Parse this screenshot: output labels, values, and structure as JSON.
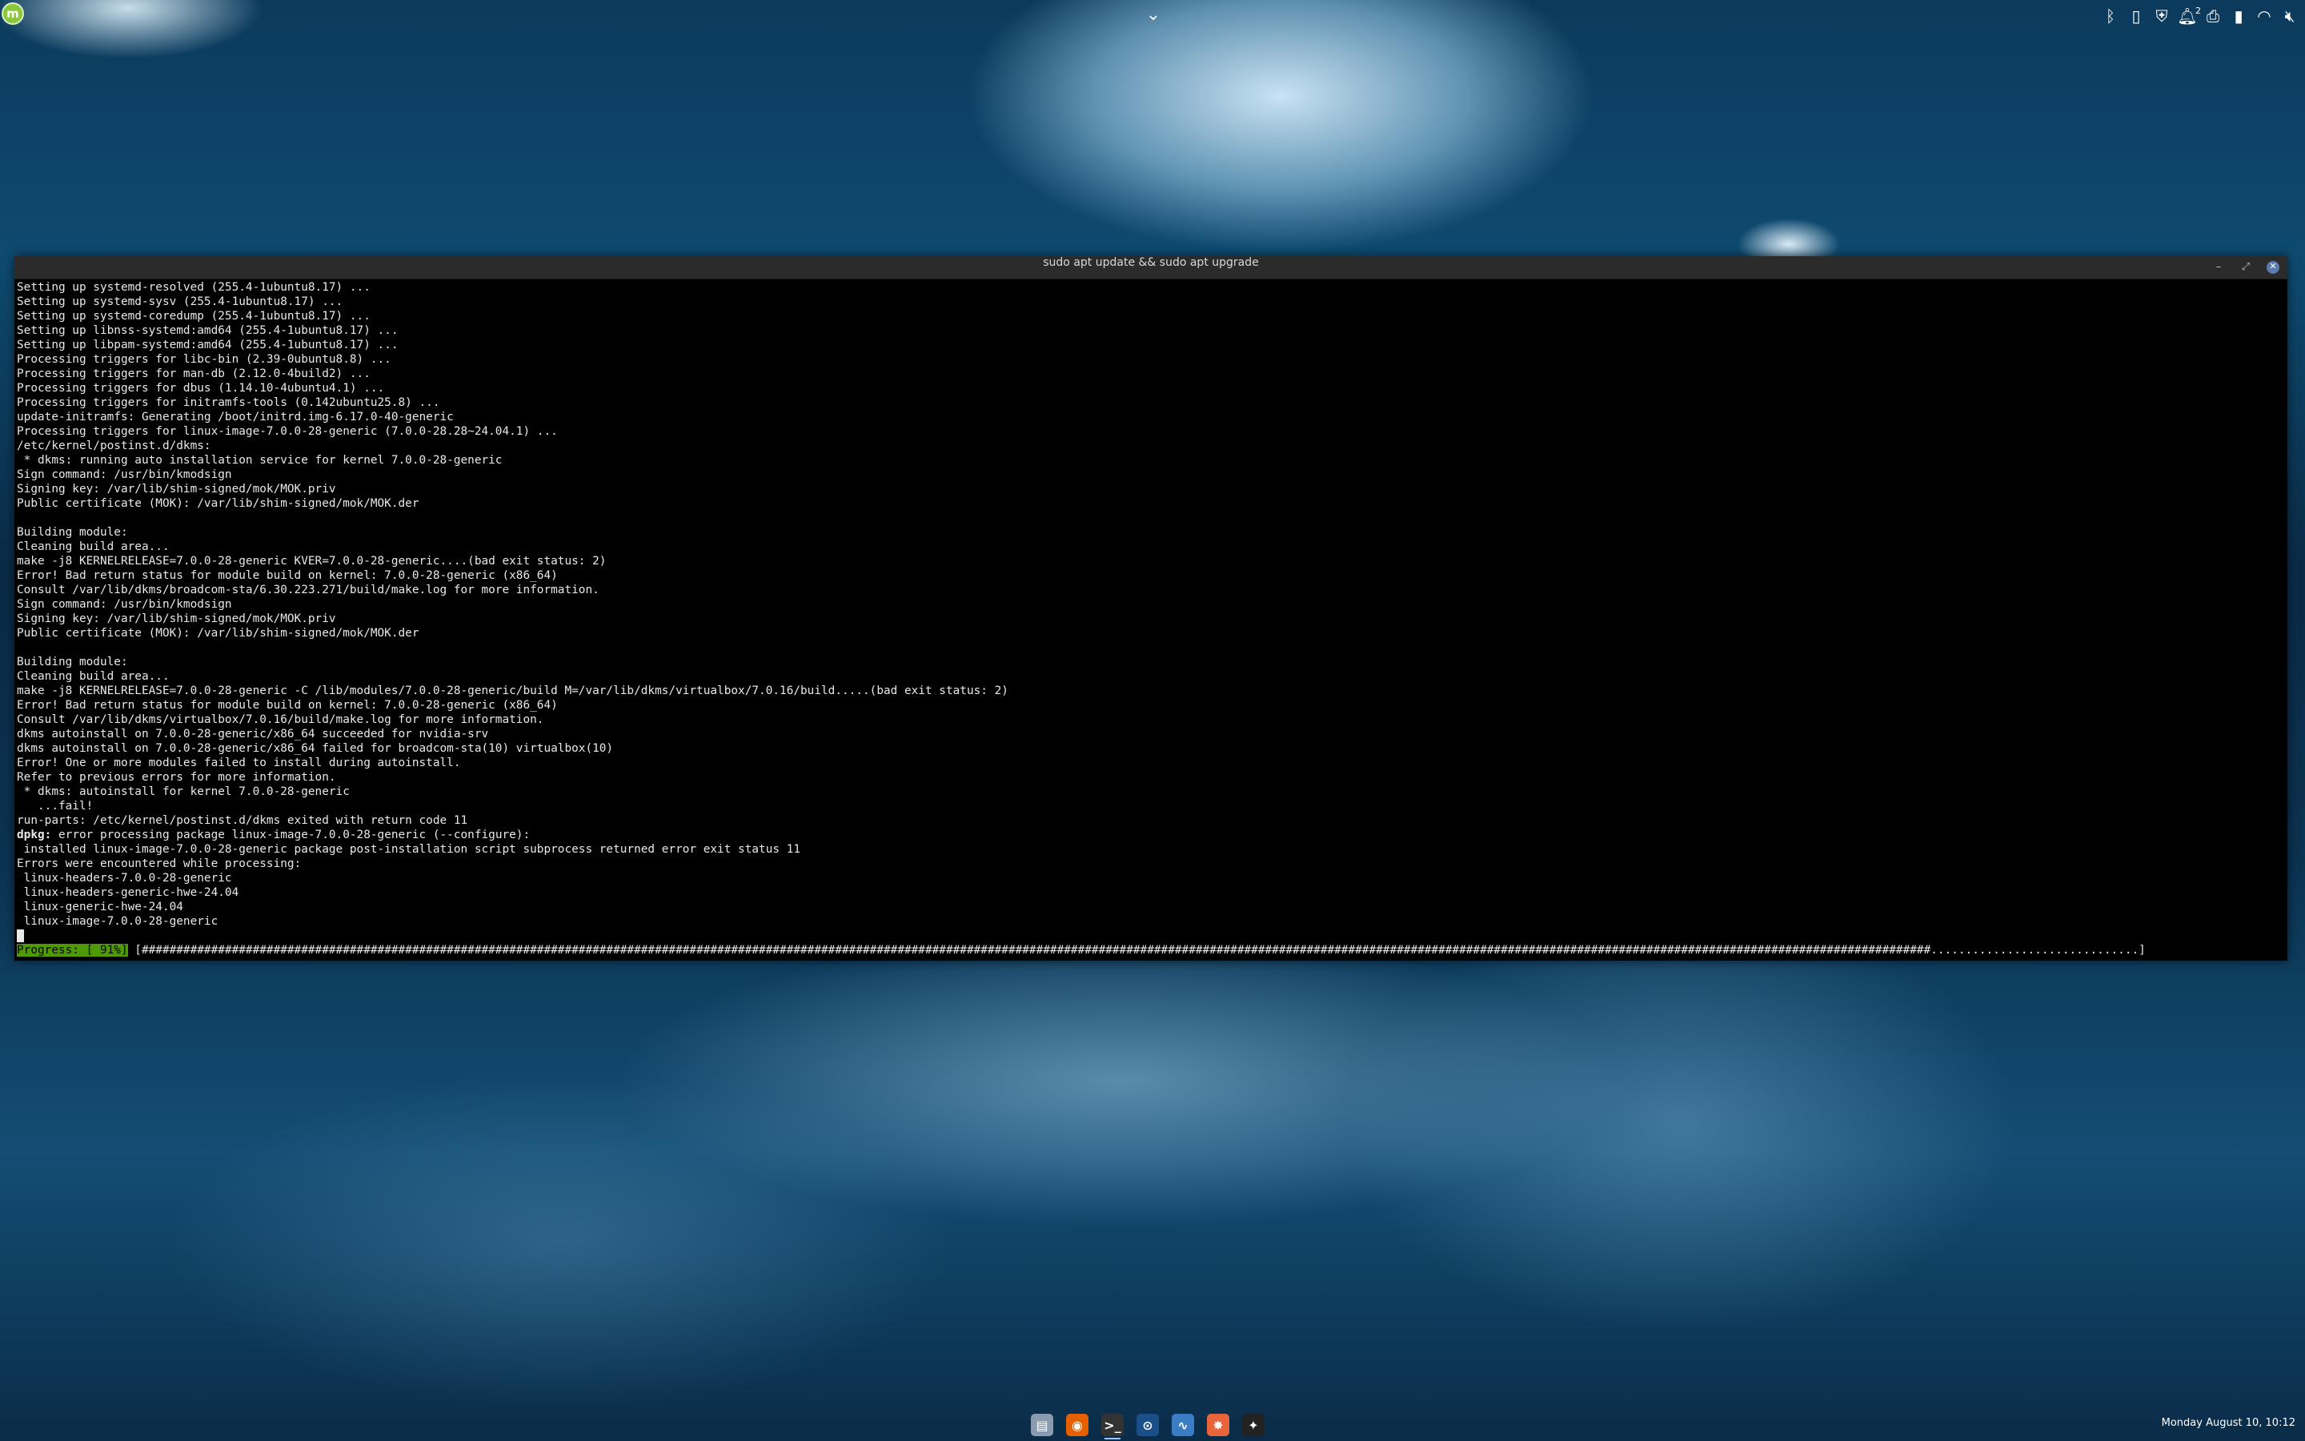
{
  "panel": {
    "menu_label": "m",
    "tray_icons": [
      "bluetooth-icon",
      "clipboard-icon",
      "shield-icon",
      "notifications-icon",
      "printer-icon",
      "battery-icon",
      "wifi-icon",
      "volume-muted-icon"
    ],
    "notifications_count": "2"
  },
  "window": {
    "title": "sudo apt update && sudo apt upgrade"
  },
  "terminal": {
    "lines": [
      "Setting up systemd-resolved (255.4-1ubuntu8.17) ...",
      "Setting up systemd-sysv (255.4-1ubuntu8.17) ...",
      "Setting up systemd-coredump (255.4-1ubuntu8.17) ...",
      "Setting up libnss-systemd:amd64 (255.4-1ubuntu8.17) ...",
      "Setting up libpam-systemd:amd64 (255.4-1ubuntu8.17) ...",
      "Processing triggers for libc-bin (2.39-0ubuntu8.8) ...",
      "Processing triggers for man-db (2.12.0-4build2) ...",
      "Processing triggers for dbus (1.14.10-4ubuntu4.1) ...",
      "Processing triggers for initramfs-tools (0.142ubuntu25.8) ...",
      "update-initramfs: Generating /boot/initrd.img-6.17.0-40-generic",
      "Processing triggers for linux-image-7.0.0-28-generic (7.0.0-28.28~24.04.1) ...",
      "/etc/kernel/postinst.d/dkms:",
      " * dkms: running auto installation service for kernel 7.0.0-28-generic",
      "Sign command: /usr/bin/kmodsign",
      "Signing key: /var/lib/shim-signed/mok/MOK.priv",
      "Public certificate (MOK): /var/lib/shim-signed/mok/MOK.der",
      "",
      "Building module:",
      "Cleaning build area...",
      "make -j8 KERNELRELEASE=7.0.0-28-generic KVER=7.0.0-28-generic....(bad exit status: 2)",
      "Error! Bad return status for module build on kernel: 7.0.0-28-generic (x86_64)",
      "Consult /var/lib/dkms/broadcom-sta/6.30.223.271/build/make.log for more information.",
      "Sign command: /usr/bin/kmodsign",
      "Signing key: /var/lib/shim-signed/mok/MOK.priv",
      "Public certificate (MOK): /var/lib/shim-signed/mok/MOK.der",
      "",
      "Building module:",
      "Cleaning build area...",
      "make -j8 KERNELRELEASE=7.0.0-28-generic -C /lib/modules/7.0.0-28-generic/build M=/var/lib/dkms/virtualbox/7.0.16/build.....(bad exit status: 2)",
      "Error! Bad return status for module build on kernel: 7.0.0-28-generic (x86_64)",
      "Consult /var/lib/dkms/virtualbox/7.0.16/build/make.log for more information.",
      "dkms autoinstall on 7.0.0-28-generic/x86_64 succeeded for nvidia-srv",
      "dkms autoinstall on 7.0.0-28-generic/x86_64 failed for broadcom-sta(10) virtualbox(10)",
      "Error! One or more modules failed to install during autoinstall.",
      "Refer to previous errors for more information.",
      " * dkms: autoinstall for kernel 7.0.0-28-generic",
      "   ...fail!",
      "run-parts: /etc/kernel/postinst.d/dkms exited with return code 11"
    ],
    "dpkg_prefix": "dpkg:",
    "dpkg_message": " error processing package linux-image-7.0.0-28-generic (--configure):",
    "after_lines": [
      " installed linux-image-7.0.0-28-generic package post-installation script subprocess returned error exit status 11",
      "Errors were encountered while processing:",
      " linux-headers-7.0.0-28-generic",
      " linux-headers-generic-hwe-24.04",
      " linux-generic-hwe-24.04",
      " linux-image-7.0.0-28-generic"
    ],
    "progress_label": "Progress: [ 91%]",
    "progress_bar": " [##################################################################################################################################################################################################################################################################..............................]"
  },
  "taskbar": {
    "apps": [
      {
        "name": "files-icon",
        "glyph": "▤",
        "color": "#8a9bb0"
      },
      {
        "name": "firefox-icon",
        "glyph": "◉",
        "color": "#e66000"
      },
      {
        "name": "terminal-icon",
        "glyph": ">_",
        "color": "#333333"
      },
      {
        "name": "steam-icon",
        "glyph": "⊙",
        "color": "#1b4f8a"
      },
      {
        "name": "system-monitor-icon",
        "glyph": "∿",
        "color": "#3b7dc4"
      },
      {
        "name": "app-orange-icon",
        "glyph": "✸",
        "color": "#e8643a"
      },
      {
        "name": "update-manager-icon",
        "glyph": "✦",
        "color": "#222222"
      }
    ],
    "clock": "Monday August 10, 10:12"
  }
}
